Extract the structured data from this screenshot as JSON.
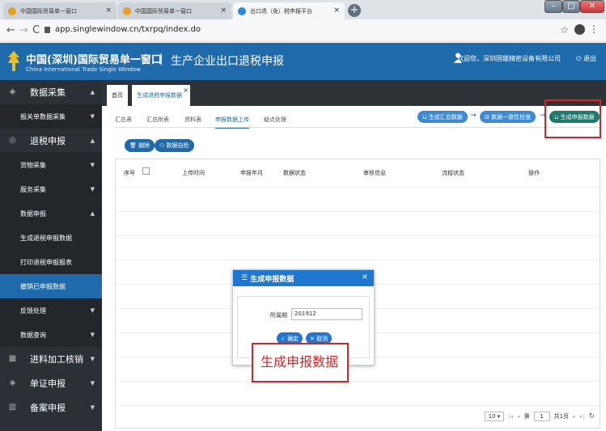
{
  "browser": {
    "tabs": [
      {
        "label": "中国国际贸易单一窗口",
        "active": false
      },
      {
        "label": "中国国际贸易单一窗口",
        "active": false
      },
      {
        "label": "出口退（免）税申报平台",
        "active": true
      }
    ],
    "new_tab_icon": "plus-icon",
    "url": "app.singlewindow.cn/txrpq/index.do"
  },
  "header": {
    "brand_cn": "中国(深圳)国际贸易单一窗口",
    "brand_en": "China International Trade Single Window",
    "separator": "|",
    "app_title": "生产企业出口退税申报",
    "user_text": "欢迎您，深圳国雄精密设备有限公司",
    "logout": "退出"
  },
  "sidebar": {
    "items": [
      {
        "label": "数据采集",
        "type": "main",
        "icon": "layers-icon",
        "caret": "▲"
      },
      {
        "label": "报关单数据采集",
        "type": "sub",
        "caret": "▼"
      },
      {
        "label": "退税申报",
        "type": "main",
        "icon": "shield-icon",
        "caret": "▲"
      },
      {
        "label": "货物采集",
        "type": "sub",
        "caret": "▼"
      },
      {
        "label": "服务采集",
        "type": "sub",
        "caret": "▼"
      },
      {
        "label": "数据申报",
        "type": "sub",
        "caret": "▲"
      },
      {
        "label": "生成退税申报数据",
        "type": "sub",
        "caret": ""
      },
      {
        "label": "打印退税申报报表",
        "type": "sub",
        "caret": ""
      },
      {
        "label": "撤销已申报数据",
        "type": "sub-active",
        "caret": ""
      },
      {
        "label": "反馈处理",
        "type": "sub",
        "caret": "▼"
      },
      {
        "label": "数据查询",
        "type": "sub",
        "caret": "▼"
      },
      {
        "label": "进料加工核销",
        "type": "main",
        "icon": "grid-icon",
        "caret": "▼"
      },
      {
        "label": "单证申报",
        "type": "main",
        "icon": "layers-icon",
        "caret": "▼"
      },
      {
        "label": "备案申报",
        "type": "main",
        "icon": "building-icon",
        "caret": "▼"
      }
    ]
  },
  "content": {
    "home_tab": "首页",
    "current_tab": "生成退税申报数据",
    "current_tab_close": "×",
    "sub_tabs": [
      "汇总表",
      "汇总附表",
      "资料表",
      "申报数据上传",
      "疑点处理"
    ],
    "active_sub_tab": "申报数据上传",
    "flow": {
      "step1": "生成汇总数据",
      "step2": "数据一致性检查",
      "step3": "生成申报数据",
      "arrow": "→"
    },
    "actions": {
      "delete": "删除",
      "self_check": "数据自检"
    },
    "table_headers": [
      "序号",
      "上传时间",
      "申报年月",
      "数据状态",
      "审核信息",
      "流程状态",
      "操作"
    ],
    "pager": {
      "page_size": "10",
      "page_label_prefix": "第",
      "page_number": "1",
      "page_total": "共1页"
    }
  },
  "dialog": {
    "title": "生成申报数据",
    "close": "×",
    "period_label": "所属期",
    "period_value": "201912",
    "ok": "确定",
    "cancel": "取消"
  },
  "callout": {
    "text": "生成申报数据"
  }
}
